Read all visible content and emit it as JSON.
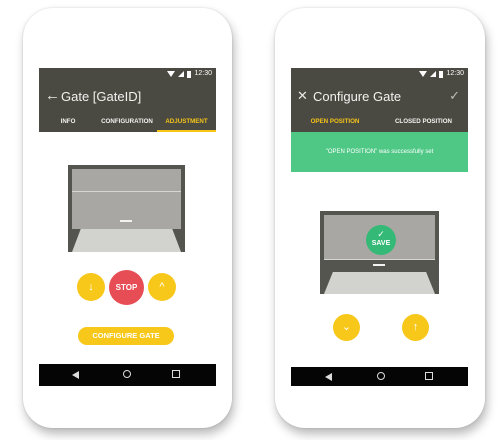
{
  "phone1": {
    "status": {
      "time": "12:30"
    },
    "appbar": {
      "back_icon": "←",
      "title": "Gate [GateID]"
    },
    "tabs": [
      {
        "label": "INFO",
        "active": false
      },
      {
        "label": "CONFIGURATION",
        "active": false
      },
      {
        "label": "ADJUSTMENT",
        "active": true
      }
    ],
    "controls": {
      "down_icon": "↓",
      "stop_label": "STOP",
      "up_icon": "^"
    },
    "configure_button": "CONFIGURE GATE"
  },
  "phone2": {
    "status": {
      "time": "12:30"
    },
    "appbar": {
      "close_icon": "✕",
      "title": "Configure Gate",
      "check_icon": "✓"
    },
    "tabs": [
      {
        "label": "OPEN POSITION",
        "active": true
      },
      {
        "label": "CLOSED POSITION",
        "active": false
      }
    ],
    "banner": {
      "text": "\"OPEN POSITION\" was successfully set"
    },
    "save": {
      "check_icon": "✓",
      "label": "SAVE"
    },
    "controls": {
      "down_icon": "⌄",
      "up_icon": "↑"
    }
  },
  "colors": {
    "accent": "#f7c71a",
    "stop": "#e64d55",
    "success": "#4fc886",
    "appbar": "#4a4942"
  }
}
